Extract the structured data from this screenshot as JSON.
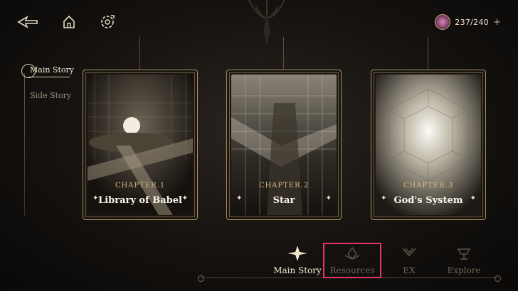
{
  "topbar": {
    "back_icon": "back-arrow-icon",
    "home_icon": "home-icon",
    "settings_icon": "settings-icon",
    "stamina": {
      "value": "237/240",
      "plus": "+"
    }
  },
  "side_nav": {
    "items": [
      {
        "label": "Main Story",
        "active": true
      },
      {
        "label": "Side Story",
        "active": false
      }
    ]
  },
  "chapters": [
    {
      "chapter": "CHAPTER.1",
      "title": "Library of Babel"
    },
    {
      "chapter": "CHAPTER.2",
      "title": "Star"
    },
    {
      "chapter": "CHAPTER.3",
      "title": "God's System"
    }
  ],
  "bottom_nav": {
    "items": [
      {
        "label": "Main Story",
        "active": true
      },
      {
        "label": "Resources",
        "active": false
      },
      {
        "label": "EX",
        "active": false
      },
      {
        "label": "Explore",
        "active": false
      }
    ]
  },
  "colors": {
    "highlight": "#e8336b",
    "gold": "#c9a86a"
  }
}
